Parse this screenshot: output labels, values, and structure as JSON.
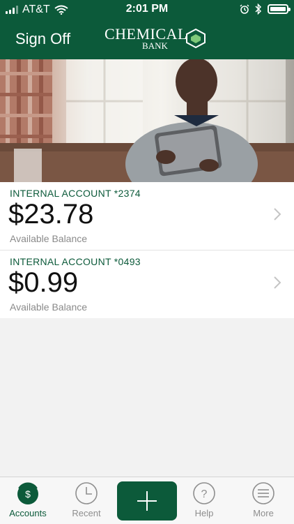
{
  "status_bar": {
    "carrier": "AT&T",
    "time": "2:01 PM"
  },
  "header": {
    "sign_off": "Sign Off",
    "logo_line1": "CHEMICAL",
    "logo_line2": "BANK"
  },
  "accounts": [
    {
      "name": "INTERNAL ACCOUNT *2374",
      "balance": "$23.78",
      "label": "Available Balance"
    },
    {
      "name": "INTERNAL ACCOUNT *0493",
      "balance": "$0.99",
      "label": "Available Balance"
    }
  ],
  "tabbar": {
    "accounts": "Accounts",
    "recent": "Recent",
    "help": "Help",
    "more": "More"
  },
  "colors": {
    "brand_green": "#0c5a3a"
  },
  "icons": [
    "signal-icon",
    "wifi-icon",
    "alarm-icon",
    "bluetooth-icon",
    "battery-icon",
    "chevron-right-icon",
    "dollar-icon",
    "clock-icon",
    "plus-icon",
    "question-icon",
    "menu-icon"
  ]
}
